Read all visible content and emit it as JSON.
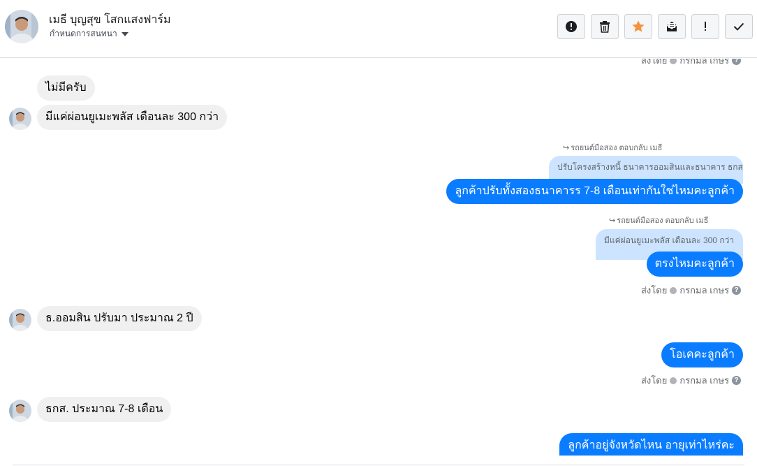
{
  "header": {
    "contact_name": "เมธี บุญสุข โสกแสงฟาร์ม",
    "assign_label": "กำหนดการสนทนา",
    "actions": [
      {
        "name": "spam-icon"
      },
      {
        "name": "trash-icon"
      },
      {
        "name": "star-icon"
      },
      {
        "name": "mark-unread-icon"
      },
      {
        "name": "flag-icon"
      },
      {
        "name": "done-check-icon"
      }
    ],
    "star_color": "#f5923e"
  },
  "thread": {
    "top_partial_sent_by": {
      "label": "ส่งโดย",
      "agent": "กรกมล เกษร"
    },
    "messages": [
      {
        "id": "m1",
        "text": "ไม่มีครับ"
      },
      {
        "id": "m2",
        "text": "มีแค่ผ่อนยูเมะพลัส เดือนละ 300 กว่า"
      },
      {
        "id": "r1_label",
        "text": "รถยนต์มือสอง ตอบกลับ เมธี"
      },
      {
        "id": "r1_quote",
        "text": "ปรับโครงสร้างหนี้ ธนาคารออมสินและธนาคาร ธกส"
      },
      {
        "id": "m3",
        "text": "ลูกค้าปรับทั้งสองธนาคารร 7-8 เดือนเท่ากันใช่ไหมคะลูกค้า"
      },
      {
        "id": "r2_label",
        "text": "รถยนต์มือสอง ตอบกลับ เมธี"
      },
      {
        "id": "r2_quote",
        "text": "มีแค่ผ่อนยูเมะพลัส เดือนละ 300 กว่า"
      },
      {
        "id": "m4",
        "text": "ตรงไหมคะลูกค้า"
      },
      {
        "id": "m5",
        "text": "ธ.ออมสิน ปรับมา ประมาณ 2 ปี"
      },
      {
        "id": "m6",
        "text": "โอเคคะลูกค้า"
      },
      {
        "id": "m7",
        "text": "ธกส. ประมาณ 7-8 เดือน"
      },
      {
        "id": "m8",
        "text": "ลูกค้าอยู่จังหวัดไหน อายุเท่าไหร่คะ"
      }
    ],
    "sent_by": [
      {
        "label": "ส่งโดย",
        "agent": "กรกมล เกษร"
      },
      {
        "label": "ส่งโดย",
        "agent": "กรกมล เกษร"
      }
    ]
  },
  "colors": {
    "outgoing_bubble": "#0a7cff",
    "incoming_bubble": "#f0f0f0",
    "quote_bubble": "#cce4ff"
  }
}
